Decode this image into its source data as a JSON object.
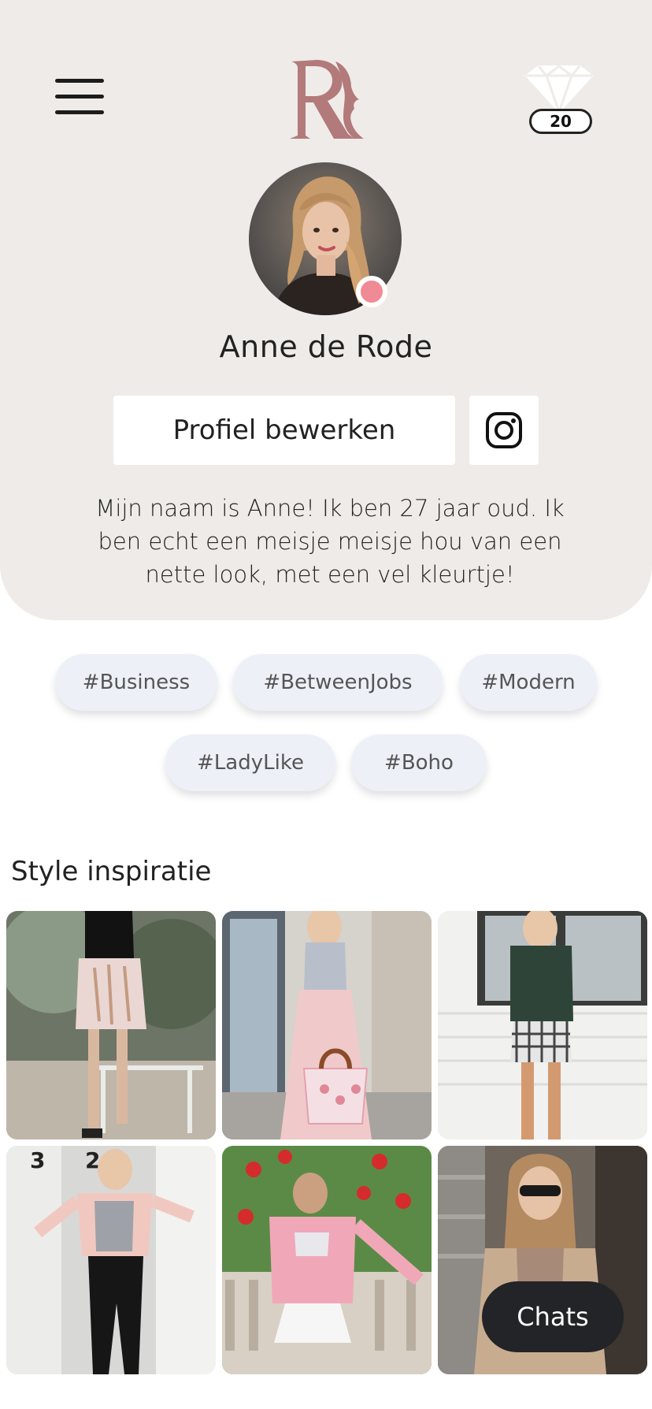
{
  "header": {
    "menu_icon": "hamburger-menu-icon",
    "logo_icon": "brand-logo-r",
    "gem_icon": "diamond-icon",
    "gem_count": "20"
  },
  "profile": {
    "name": "Anne de Rode",
    "status_color": "#f08a94",
    "edit_button_label": "Profiel bewerken",
    "instagram_icon": "instagram-icon",
    "bio": "Mijn naam is Anne! Ik ben 27 jaar oud. Ik ben echt een meisje meisje hou van een nette look, met een vel kleurtje!"
  },
  "tags": [
    "#Business",
    "#BetweenJobs",
    "#Modern",
    "#LadyLike",
    "#Boho"
  ],
  "inspiration": {
    "title": "Style inspiratie"
  },
  "chats": {
    "label": "Chats"
  },
  "colors": {
    "header_bg": "#efebe8",
    "brand_mauve": "#b27a7a",
    "tag_bg": "#eef0f8",
    "chats_bg": "#222427"
  }
}
